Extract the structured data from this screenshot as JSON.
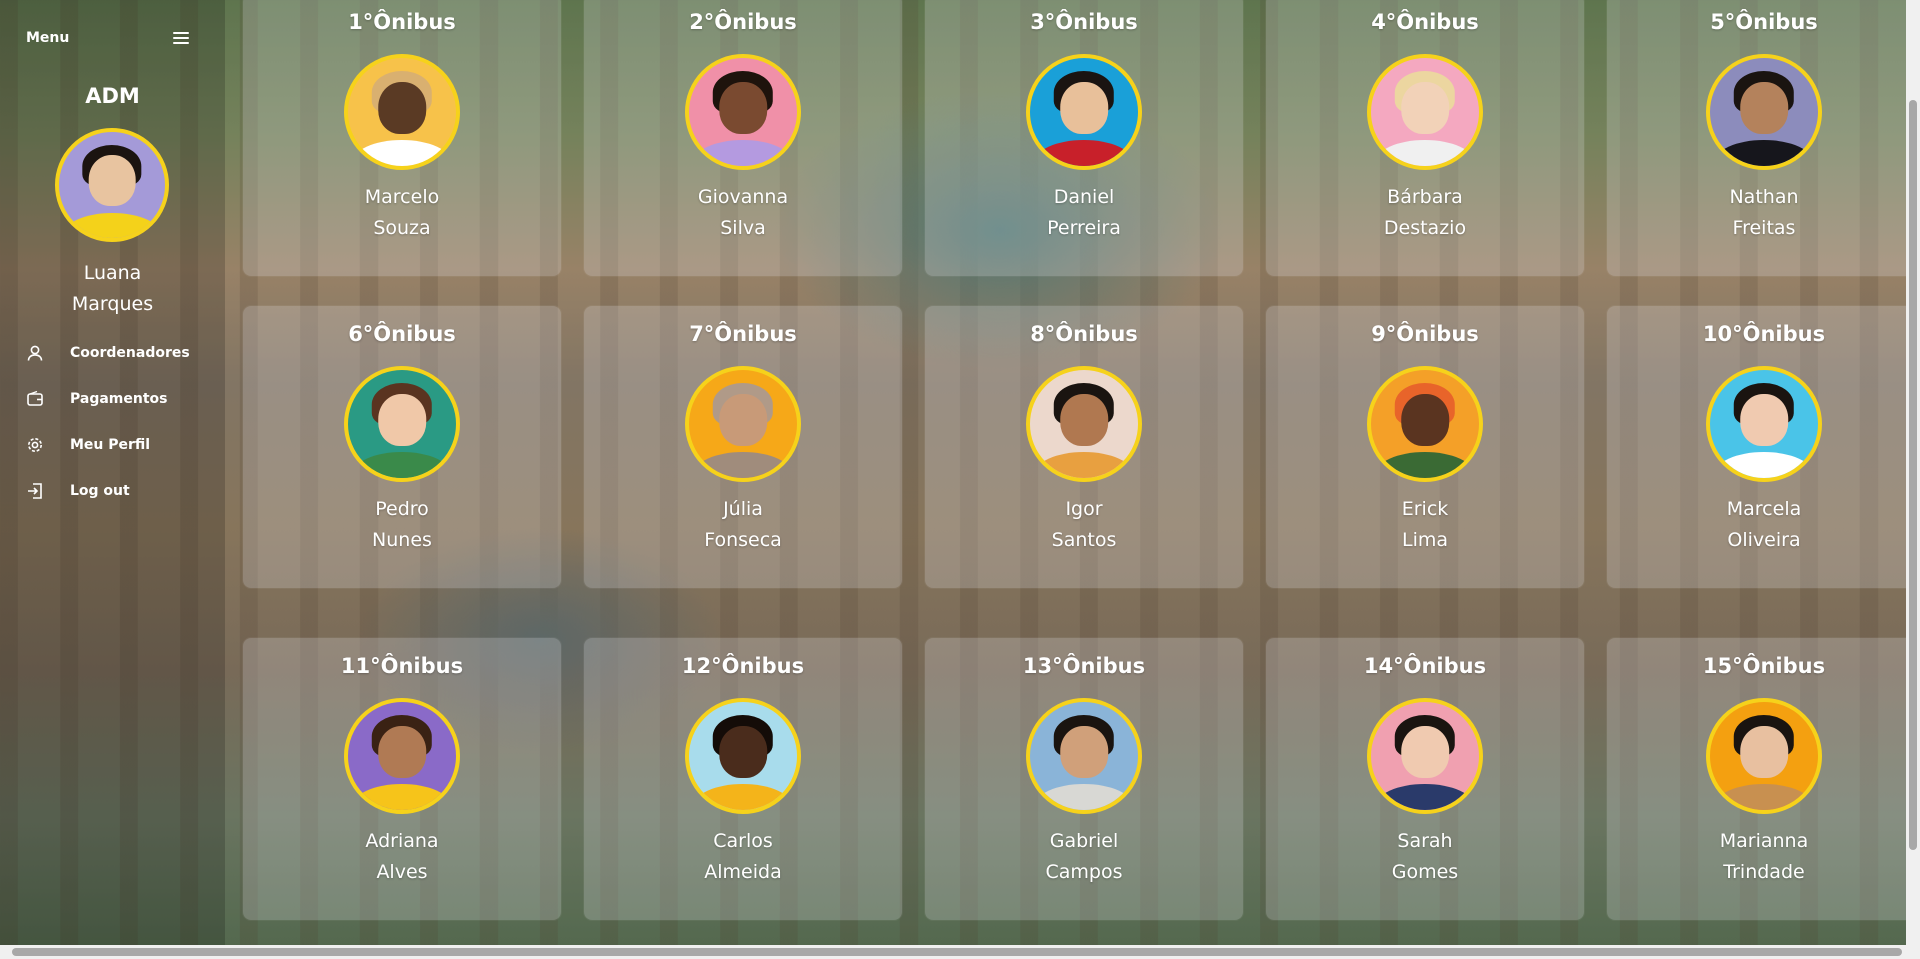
{
  "sidebar": {
    "menu_label": "Menu",
    "role": "ADM",
    "user": {
      "first": "Luana",
      "last": "Marques",
      "bg": "#a49ad8",
      "skin": "#e8c4a0",
      "hair": "#1b1410",
      "shirt": "#f4d21a"
    },
    "items": [
      {
        "label": "Coordenadores",
        "icon": "user-icon"
      },
      {
        "label": "Pagamentos",
        "icon": "wallet-icon"
      },
      {
        "label": "Meu Perfil",
        "icon": "gear-icon"
      },
      {
        "label": "Log out",
        "icon": "logout-icon"
      }
    ]
  },
  "colors": {
    "accent": "#f6d21b",
    "text": "#ffffff"
  },
  "buses": [
    {
      "title": "1°Ônibus",
      "first": "Marcelo",
      "last": "Souza",
      "bg": "#f7c24a",
      "skin": "#5a3a24",
      "hair": "#d9b070",
      "shirt": "#ffffff"
    },
    {
      "title": "2°Ônibus",
      "first": "Giovanna",
      "last": "Silva",
      "bg": "#f090a8",
      "skin": "#7a4a30",
      "hair": "#1e130c",
      "shirt": "#b49ae0"
    },
    {
      "title": "3°Ônibus",
      "first": "Daniel",
      "last": "Perreira",
      "bg": "#1aa0d8",
      "skin": "#e8c09a",
      "hair": "#1a1412",
      "shirt": "#c8202a"
    },
    {
      "title": "4°Ônibus",
      "first": "Bárbara",
      "last": "Destazio",
      "bg": "#f4a8c0",
      "skin": "#f2d2b8",
      "hair": "#ecd6a0",
      "shirt": "#f0f0f0"
    },
    {
      "title": "5°Ônibus",
      "first": "Nathan",
      "last": "Freitas",
      "bg": "#8c8cbc",
      "skin": "#b4825c",
      "hair": "#1a1410",
      "shirt": "#16161c"
    },
    {
      "title": "6°Ônibus",
      "first": "Pedro",
      "last": "Nunes",
      "bg": "#2a9a84",
      "skin": "#f0c8a8",
      "hair": "#5a3420",
      "shirt": "#3a8a4a"
    },
    {
      "title": "7°Ônibus",
      "first": "Júlia",
      "last": "Fonseca",
      "bg": "#f6a818",
      "skin": "#c89a78",
      "hair": "#b09a88",
      "shirt": "#a08c7c"
    },
    {
      "title": "8°Ônibus",
      "first": "Igor",
      "last": "Santos",
      "bg": "#ecd8cc",
      "skin": "#b07850",
      "hair": "#1a1410",
      "shirt": "#e8a040"
    },
    {
      "title": "9°Ônibus",
      "first": "Erick",
      "last": "Lima",
      "bg": "#f4a028",
      "skin": "#5a3420",
      "hair": "#e8642a",
      "shirt": "#3a6a34"
    },
    {
      "title": "10°Ônibus",
      "first": "Marcela",
      "last": "Oliveira",
      "bg": "#4ac4e8",
      "skin": "#f0cab0",
      "hair": "#1a1410",
      "shirt": "#ffffff"
    },
    {
      "title": "11°Ônibus",
      "first": "Adriana",
      "last": "Alves",
      "bg": "#8a6ac8",
      "skin": "#b07a54",
      "hair": "#3a2214",
      "shirt": "#f6c41a"
    },
    {
      "title": "12°Ônibus",
      "first": "Carlos",
      "last": "Almeida",
      "bg": "#a8dcec",
      "skin": "#4a2c1c",
      "hair": "#140c08",
      "shirt": "#f4b41a"
    },
    {
      "title": "13°Ônibus",
      "first": "Gabriel",
      "last": "Campos",
      "bg": "#8ab4d8",
      "skin": "#d0a07a",
      "hair": "#1a1410",
      "shirt": "#d8d8d4"
    },
    {
      "title": "14°Ônibus",
      "first": "Sarah",
      "last": "Gomes",
      "bg": "#f0a0b0",
      "skin": "#f0cab0",
      "hair": "#1a1410",
      "shirt": "#2a3a6a"
    },
    {
      "title": "15°Ônibus",
      "first": "Marianna",
      "last": "Trindade",
      "bg": "#f4a010",
      "skin": "#e8c0a0",
      "hair": "#1a1410",
      "shirt": "#c89050"
    }
  ]
}
